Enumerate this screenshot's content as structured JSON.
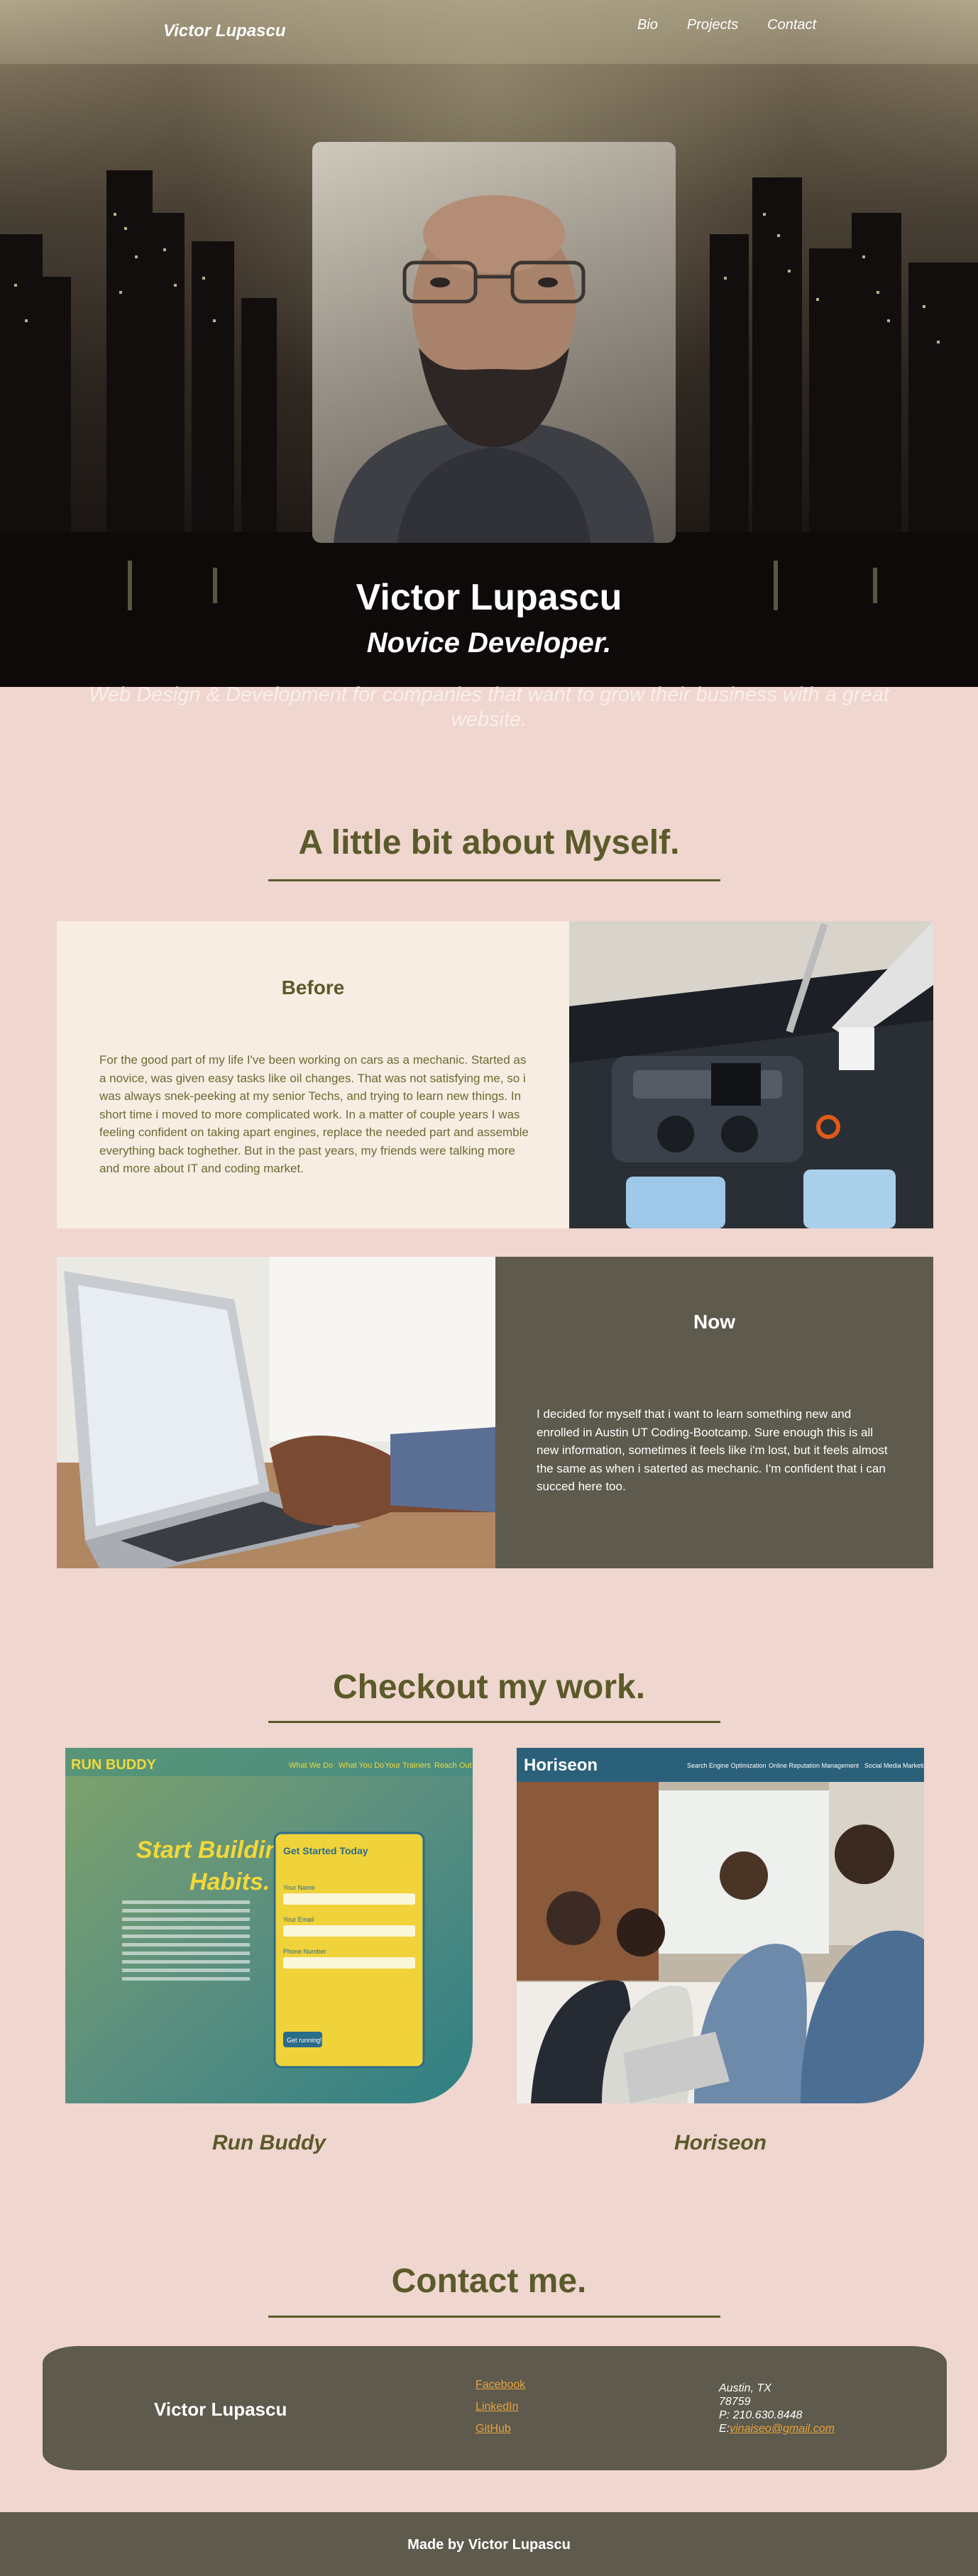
{
  "nav": {
    "brand": "Victor Lupascu",
    "links": [
      "Bio",
      "Projects",
      "Contact"
    ]
  },
  "hero": {
    "name": "Victor Lupascu",
    "role": "Novice Developer.",
    "tagline": "Web Design & Development for companies that want to grow their business with a great website."
  },
  "about": {
    "heading": "A little bit about Myself.",
    "before": {
      "title": "Before",
      "text": "For the good part of my life I've been working on cars as a mechanic. Started as a novice, was given easy tasks like oil changes. That was not satisfying me, so i was always snek-peeking at my senior Techs, and trying to learn new things. In short time i moved to more complicated work. In a matter of couple years I was feeling confident on taking apart engines, replace the needed part and assemble everything back toghether. But in the past years, my friends were talking more and more about IT and coding market."
    },
    "now": {
      "title": "Now",
      "text": "I decided for myself that i want to learn something new and enrolled in Austin UT Coding-Bootcamp. Sure enough this is all new information, sometimes it feels like i'm lost, but it feels almost the same as when i saterted as mechanic. I'm confident that i can succed here too."
    }
  },
  "work": {
    "heading": "Checkout my work.",
    "projects": [
      {
        "title": "Run Buddy",
        "preview": {
          "logo": "RUN BUDDY",
          "nav": [
            "What We Do",
            "What You Do",
            "Your Trainers",
            "Reach Out"
          ],
          "headline1": "Start Building",
          "headline2": "Habits.",
          "form_title": "Get Started Today",
          "form_fields": [
            "Your Name",
            "Your Email",
            "Phone Number"
          ],
          "form_button": "Get running!"
        }
      },
      {
        "title": "Horiseon",
        "preview": {
          "logo": "Horiseon",
          "nav": [
            "Search Engine Optimization",
            "Online Reputation Management",
            "Social Media Marketing"
          ]
        }
      }
    ]
  },
  "contact": {
    "heading": "Contact me.",
    "name": "Victor Lupascu",
    "links": [
      "Facebook",
      "LinkedIn",
      "GitHub"
    ],
    "city": "Austin, TX",
    "zip": "78759",
    "phone": "P: 210.630.8448",
    "email_prefix": "E:",
    "email": "vinaiseo@gmail.com"
  },
  "footer": {
    "text": "Made by Victor Lupascu"
  }
}
